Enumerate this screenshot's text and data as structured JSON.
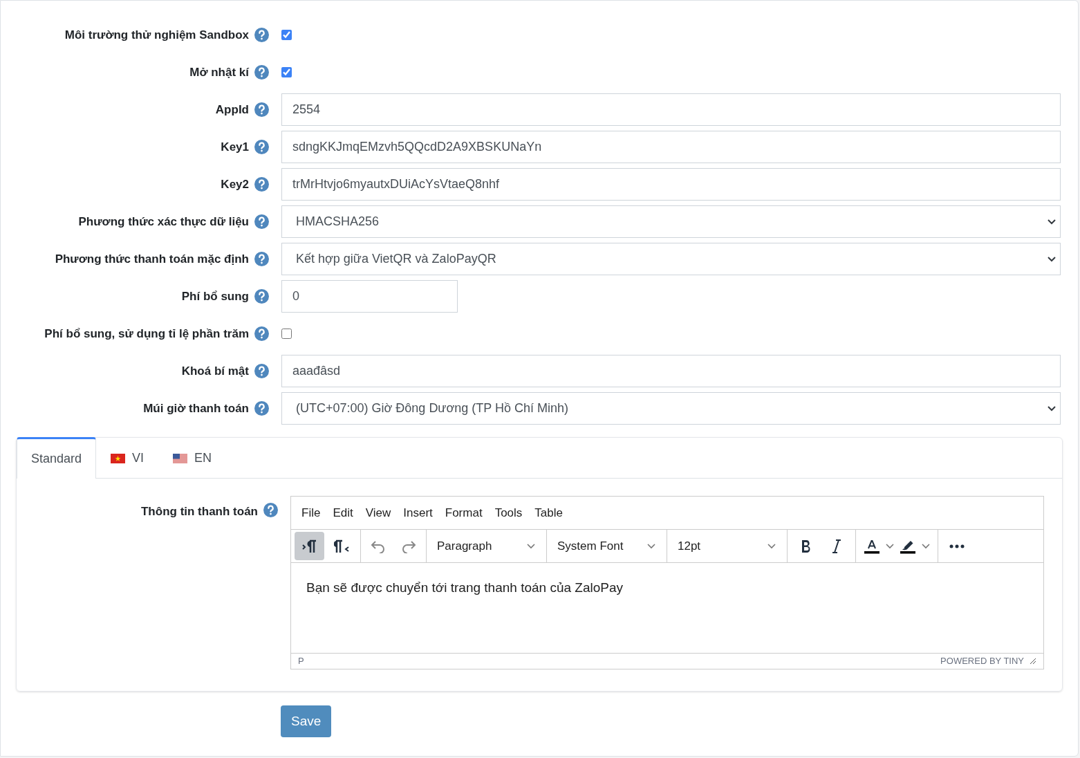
{
  "fields": [
    {
      "label": "Môi trường thử nghiệm Sandbox",
      "kind": "checkbox",
      "checked": true
    },
    {
      "label": "Mở nhật kí",
      "kind": "checkbox",
      "checked": true
    },
    {
      "label": "AppId",
      "kind": "text",
      "value": "2554"
    },
    {
      "label": "Key1",
      "kind": "text",
      "value": "sdngKKJmqEMzvh5QQcdD2A9XBSKUNaYn"
    },
    {
      "label": "Key2",
      "kind": "text",
      "value": "trMrHtvjo6myautxDUiAcYsVtaeQ8nhf"
    },
    {
      "label": "Phương thức xác thực dữ liệu",
      "kind": "select",
      "value": "HMACSHA256"
    },
    {
      "label": "Phương thức thanh toán mặc định",
      "kind": "select",
      "value": "Kết hợp giữa VietQR và ZaloPayQR"
    },
    {
      "label": "Phí bổ sung",
      "kind": "number",
      "value": "0"
    },
    {
      "label": "Phí bổ sung, sử dụng tỉ lệ phần trăm",
      "kind": "checkbox",
      "checked": false
    },
    {
      "label": "Khoá bí mật",
      "kind": "text",
      "value": "aaađâsd"
    },
    {
      "label": "Múi giờ thanh toán",
      "kind": "select",
      "value": "(UTC+07:00) Giờ Đông Dương (TP Hồ Chí Minh)"
    }
  ],
  "tabs": [
    {
      "label": "Standard",
      "selected": true
    },
    {
      "label": "VI",
      "selected": false
    },
    {
      "label": "EN",
      "selected": false
    }
  ],
  "editor": {
    "label": "Thông tin thanh toán",
    "menu": [
      "File",
      "Edit",
      "View",
      "Insert",
      "Format",
      "Tools",
      "Table"
    ],
    "direction_buttons": [
      {
        "selected": true
      },
      {
        "selected": false
      }
    ],
    "block_format": "Paragraph",
    "font_family": "System Font",
    "font_size": "12pt",
    "content": "Bạn sẽ được chuyển tới trang thanh toán của ZaloPay",
    "path": "P",
    "branding": "POWERED BY TINY"
  },
  "save_button": "Save"
}
